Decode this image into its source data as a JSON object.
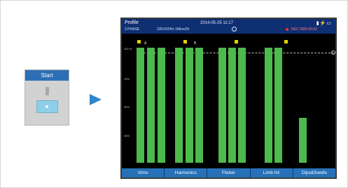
{
  "start_panel": {
    "button_label": "Start"
  },
  "screen": {
    "title": "Profile",
    "subtitle": "3 PHASE",
    "readings": "230V/50Hz   1Mins/2h",
    "datetime": "2014-05-25 11:17",
    "status_text": "REC 0000:00:02",
    "y_axis": {
      "top": "100 %",
      "upper": "75%",
      "mid": "50%",
      "lower": "25%"
    },
    "markers": [
      "A",
      "B"
    ],
    "tabs": [
      "Vrms",
      "Harmonics",
      "Flicker",
      "Limb Hz",
      "Dips&Swells"
    ]
  },
  "chart_data": {
    "type": "bar",
    "ylim": [
      0,
      100
    ],
    "values": [
      100,
      100,
      100,
      100,
      100,
      100,
      100,
      100,
      100,
      100,
      100,
      39
    ],
    "colors": {
      "bar": "#4cba4c",
      "marker": "#e8d000",
      "tab": "#2671b8",
      "header": "#0f2f73"
    }
  }
}
